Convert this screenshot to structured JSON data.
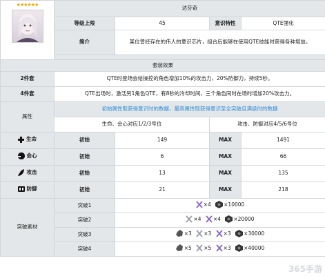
{
  "card": {
    "stars": "★★★★★★",
    "name": "达芬奇",
    "level_label": "等级上限",
    "level_value": "45",
    "trait_label": "意识特性",
    "trait_value": "QTE强化",
    "intro_label": "简介",
    "intro_text": "某位曾经存在的伟人的意识芯片，组合后能够在使用QTE技能时获得各种增益。"
  },
  "set_effects": {
    "title": "套装效果",
    "two_label": "2件套",
    "two_text": "QTE时登场会给操控的角色增加10%的攻击力，20%防御力，持续5秒。",
    "four_label": "4件套",
    "four_text": "QTE出场时，激活另1角色QTE，有8秒的冷却时间，三个角色同时在场时增加20%攻击力。"
  },
  "attributes": {
    "label": "属性",
    "note": "初始属性取获得意识时的数据，最高属性取获得意识至全突破且满级时的数据",
    "slot_left": "生命、会心对应1/2/3号位",
    "slot_right": "攻击、防御对应4/5/6号位",
    "init_label": "初始",
    "max_label": "MAX",
    "rows": [
      {
        "icon": "cross-icon",
        "name": "生命",
        "init": "149",
        "max": "1491"
      },
      {
        "icon": "crit-icon",
        "name": "会心",
        "init": "6",
        "max": "66"
      },
      {
        "icon": "attack-icon",
        "name": "攻击",
        "init": "13",
        "max": "135"
      },
      {
        "icon": "defense-icon",
        "name": "防御",
        "init": "21",
        "max": "218"
      }
    ]
  },
  "breakthrough": {
    "label": "突破素材",
    "rows": [
      {
        "name": "突破1",
        "items": [
          {
            "type": "purple",
            "count": "×4"
          },
          {
            "type": "coin",
            "count": "×10000"
          }
        ]
      },
      {
        "name": "突破2",
        "items": [
          {
            "type": "grey",
            "count": "×4"
          },
          {
            "type": "purple",
            "count": "×4"
          },
          {
            "type": "coin",
            "count": "×20000"
          }
        ]
      },
      {
        "name": "突破3",
        "items": [
          {
            "type": "ore",
            "count": "×3"
          },
          {
            "type": "grey",
            "count": "×3"
          },
          {
            "type": "purple",
            "count": "×3"
          },
          {
            "type": "coin",
            "count": "×30000"
          }
        ]
      },
      {
        "name": "突破4",
        "items": [
          {
            "type": "ore",
            "count": "×5"
          },
          {
            "type": "grey",
            "count": "×5"
          },
          {
            "type": "purple",
            "count": "×3"
          },
          {
            "type": "coin",
            "count": "×40000"
          }
        ]
      }
    ]
  },
  "watermark": "365手游"
}
